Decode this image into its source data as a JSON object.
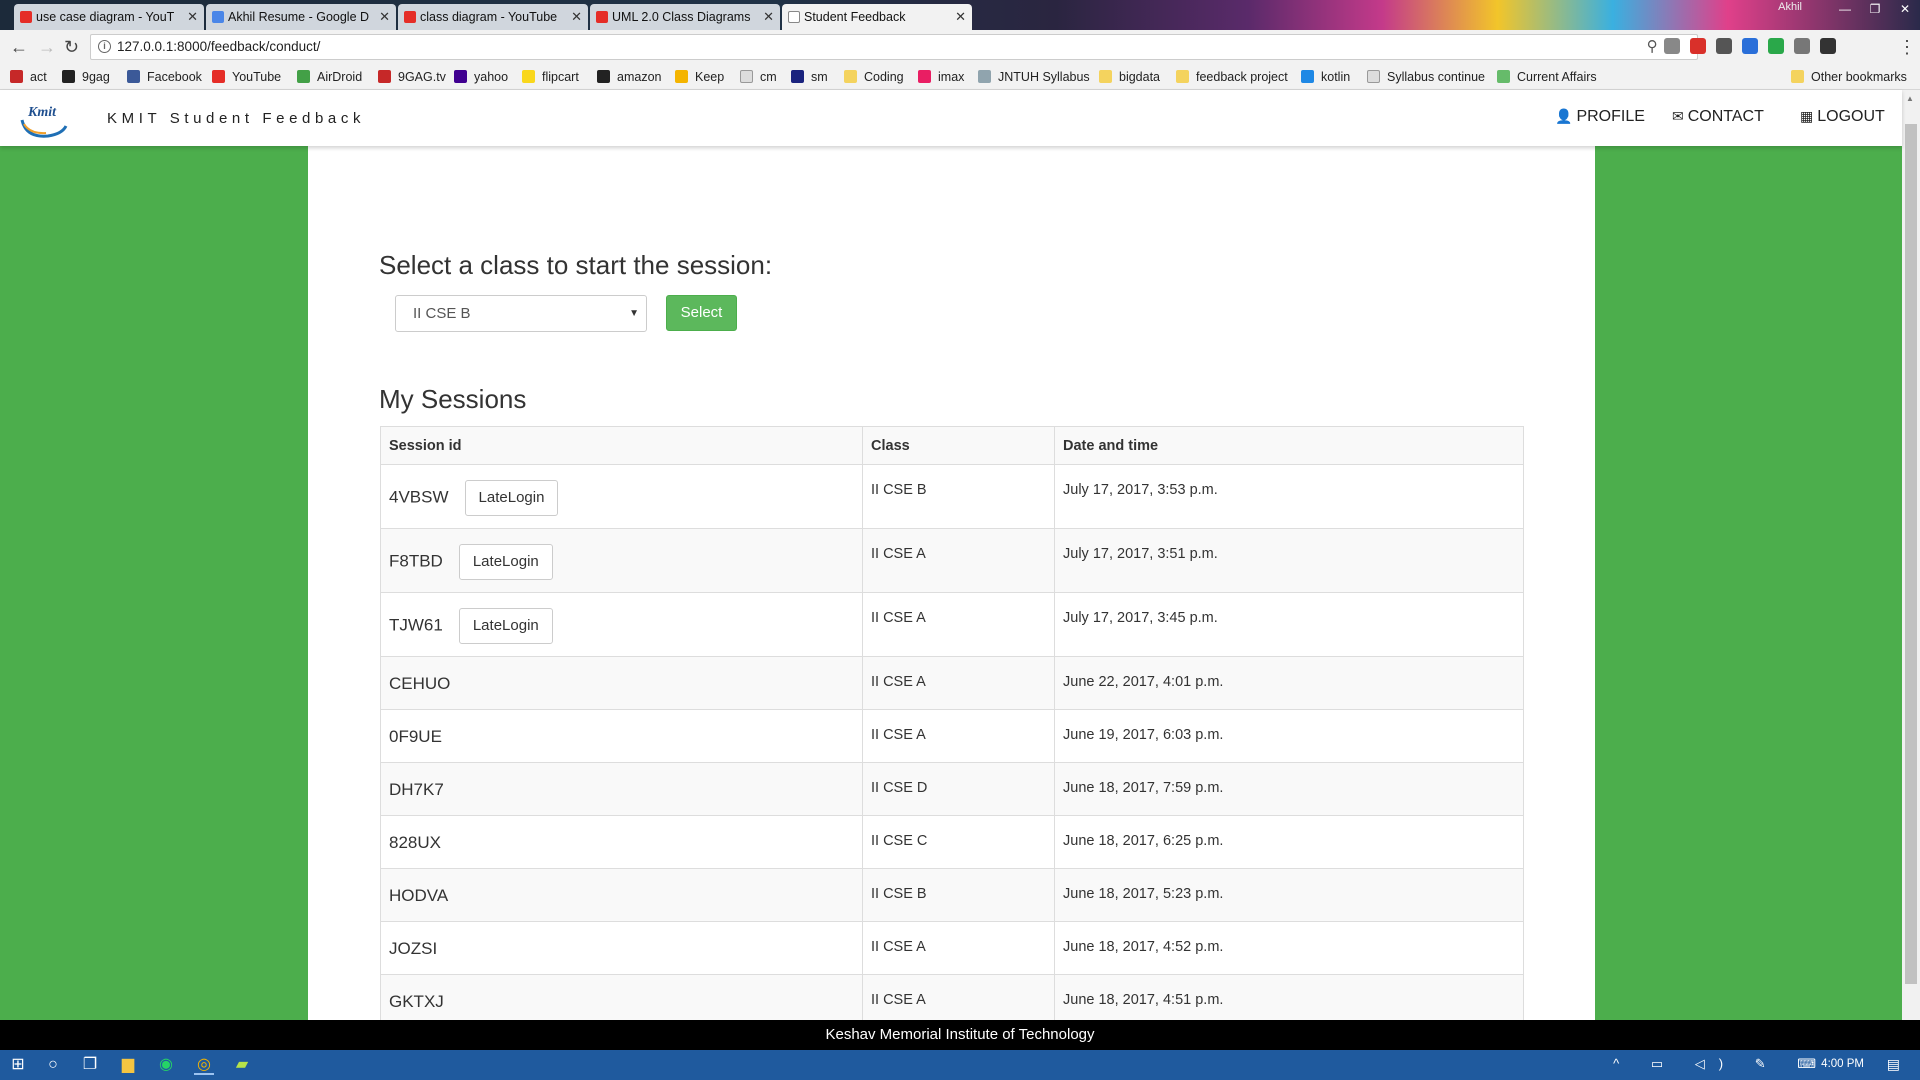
{
  "browser": {
    "tabs": [
      {
        "title": "use case diagram - YouT",
        "favicon": "youtube-icon",
        "color": "#e52d27"
      },
      {
        "title": "Akhil Resume - Google D",
        "favicon": "docs-icon",
        "color": "#4a86e8"
      },
      {
        "title": "class diagram - YouTube",
        "favicon": "youtube-icon",
        "color": "#e52d27"
      },
      {
        "title": "UML 2.0 Class Diagrams",
        "favicon": "youtube-icon",
        "color": "#e52d27"
      },
      {
        "title": "Student Feedback",
        "favicon": "page-icon",
        "color": "#ffffff"
      }
    ],
    "tab_close": "✕",
    "profile_name": "Akhil",
    "window_controls": [
      "—",
      "❐",
      "✕"
    ],
    "url": "127.0.0.1:8000/feedback/conduct/",
    "url_info": "i",
    "url_right_icons": "⚲☆",
    "nav": {
      "back": "←",
      "forward": "→",
      "reload": "↻",
      "menu": "⋮"
    },
    "extension_colors": [
      "#888888",
      "#d9302a",
      "#555555",
      "#2a6fd9",
      "#2aa84a",
      "#777777",
      "#333333"
    ],
    "bookmarks": [
      {
        "label": "act",
        "color": "#c62828"
      },
      {
        "label": "9gag",
        "color": "#222222"
      },
      {
        "label": "Facebook",
        "color": "#3b5998"
      },
      {
        "label": "YouTube",
        "color": "#e52d27"
      },
      {
        "label": "AirDroid",
        "color": "#43a047"
      },
      {
        "label": "9GAG.tv",
        "color": "#c62828"
      },
      {
        "label": "yahoo",
        "color": "#400090"
      },
      {
        "label": "flipcart",
        "color": "#f9d71c"
      },
      {
        "label": "amazon",
        "color": "#222222"
      },
      {
        "label": "Keep",
        "color": "#f4b400"
      },
      {
        "label": "cm",
        "color": "#dddddd"
      },
      {
        "label": "sm",
        "color": "#1a237e"
      },
      {
        "label": "Coding",
        "color": "#f4d35e"
      },
      {
        "label": "imax",
        "color": "#e91e63"
      },
      {
        "label": "JNTUH Syllabus",
        "color": "#90a4ae"
      },
      {
        "label": "bigdata",
        "color": "#f4d35e"
      },
      {
        "label": "feedback project",
        "color": "#f4d35e"
      },
      {
        "label": "kotlin",
        "color": "#1e88e5"
      },
      {
        "label": "Syllabus continue",
        "color": "#dddddd"
      },
      {
        "label": "Current Affairs",
        "color": "#66bb6a"
      }
    ],
    "other_bookmarks": "Other bookmarks"
  },
  "app": {
    "logo_text": "Kmit",
    "brand": "KMIT Student Feedback",
    "nav": {
      "profile": {
        "icon": "user-icon",
        "glyph": "👤",
        "label": "PROFILE"
      },
      "contact": {
        "icon": "envelope-icon",
        "glyph": "✉",
        "label": "CONTACT"
      },
      "logout": {
        "icon": "grid-icon",
        "glyph": "▦",
        "label": "LOGOUT"
      }
    },
    "accent": "#4cae4c"
  },
  "main": {
    "select_heading": "Select a class to start the session:",
    "class_select": {
      "selected": "II CSE B",
      "caret": "▼"
    },
    "select_button": "Select",
    "sessions_heading": "My Sessions",
    "table": {
      "headers": [
        "Session id",
        "Class",
        "Date and time"
      ],
      "late_login_label": "LateLogin",
      "rows": [
        {
          "id": "4VBSW",
          "class": "II CSE B",
          "datetime": "July 17, 2017, 3:53 p.m.",
          "late_login": true
        },
        {
          "id": "F8TBD",
          "class": "II CSE A",
          "datetime": "July 17, 2017, 3:51 p.m.",
          "late_login": true
        },
        {
          "id": "TJW61",
          "class": "II CSE A",
          "datetime": "July 17, 2017, 3:45 p.m.",
          "late_login": true
        },
        {
          "id": "CEHUO",
          "class": "II CSE A",
          "datetime": "June 22, 2017, 4:01 p.m.",
          "late_login": false
        },
        {
          "id": "0F9UE",
          "class": "II CSE A",
          "datetime": "June 19, 2017, 6:03 p.m.",
          "late_login": false
        },
        {
          "id": "DH7K7",
          "class": "II CSE D",
          "datetime": "June 18, 2017, 7:59 p.m.",
          "late_login": false
        },
        {
          "id": "828UX",
          "class": "II CSE C",
          "datetime": "June 18, 2017, 6:25 p.m.",
          "late_login": false
        },
        {
          "id": "HODVA",
          "class": "II CSE B",
          "datetime": "June 18, 2017, 5:23 p.m.",
          "late_login": false
        },
        {
          "id": "JOZSI",
          "class": "II CSE A",
          "datetime": "June 18, 2017, 4:52 p.m.",
          "late_login": false
        },
        {
          "id": "GKTXJ",
          "class": "II CSE A",
          "datetime": "June 18, 2017, 4:51 p.m.",
          "late_login": false
        }
      ]
    }
  },
  "footer": {
    "text": "Keshav Memorial Institute of Technology"
  },
  "taskbar": {
    "start": "⊞",
    "search": "○",
    "task_view": "❐",
    "apps": [
      {
        "name": "file-explorer-icon",
        "glyph": "▆",
        "color": "#f4c542"
      },
      {
        "name": "whatsapp-icon",
        "glyph": "◉",
        "color": "#25d366"
      },
      {
        "name": "chrome-icon",
        "glyph": "◎",
        "color": "#f4b400"
      },
      {
        "name": "pycharm-icon",
        "glyph": "▰",
        "color": "#b6e34a"
      }
    ],
    "tray": "^ ▭ ◁) ✎ ⌨",
    "clock": "4:00 PM",
    "notifications": "▤"
  }
}
